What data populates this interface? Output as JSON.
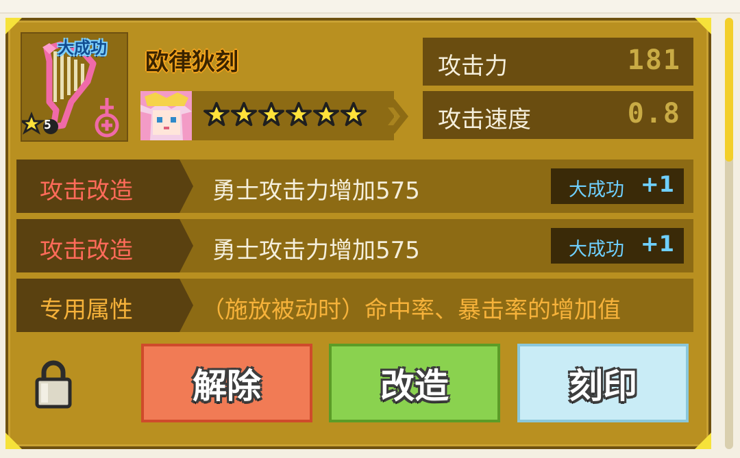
{
  "item": {
    "badge": "大成功",
    "name": "欧律狄刻",
    "level": "5",
    "star_count": 6
  },
  "stats": [
    {
      "label": "攻击力",
      "value": "181"
    },
    {
      "label": "攻击速度",
      "value": "0.8"
    }
  ],
  "options": [
    {
      "tag": "攻击改造",
      "tag_color": "#ff6b5a",
      "desc": "勇士攻击力增加575",
      "great": "大成功",
      "bonus": "+1"
    },
    {
      "tag": "攻击改造",
      "tag_color": "#ff6b5a",
      "desc": "勇士攻击力增加575",
      "great": "大成功",
      "bonus": "+1"
    },
    {
      "tag": "专用属性",
      "tag_color": "#f6b23a",
      "desc": "（施放被动时）命中率、暴击率的增加值",
      "desc_color": "#f6b23a"
    }
  ],
  "buttons": {
    "release": "解除",
    "reforge": "改造",
    "engrave": "刻印"
  },
  "colors": {
    "panel": "#b99020",
    "accent_yellow": "#f6e23a",
    "great_success": "#6fd0ff"
  }
}
